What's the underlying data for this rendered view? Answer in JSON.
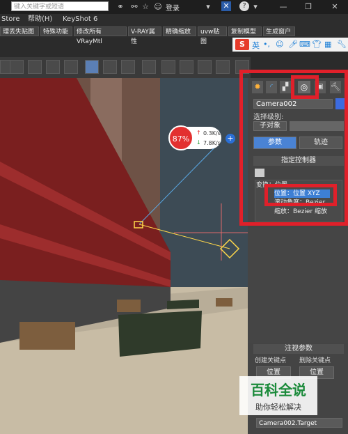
{
  "titlebar": {
    "search_placeholder": "键入关键字或短语",
    "login": "登录",
    "store": "Store"
  },
  "menu": [
    "Store",
    "帮助(H)",
    "KeyShot 6"
  ],
  "plugin_toolbar": [
    "理丢失贴图",
    "特殊功能",
    "修改所有VRayMtl",
    "V-RAY属性",
    "精确缩放",
    "uvw贴图",
    "复制模型",
    "生成窗户"
  ],
  "ime": {
    "logo": "S",
    "lang": "英"
  },
  "viewport": {
    "speed_percent": "87%",
    "upload": "0.3K/s",
    "download": "7.8K/s"
  },
  "panel": {
    "object_name": "Camera002",
    "selection_level_label": "选择级别:",
    "sub_object": "子对象",
    "tab_params": "参数",
    "tab_track": "轨迹",
    "assign_controller": "指定控制器",
    "tree": {
      "root": "变换：位置",
      "position": "位置：位置 XYZ",
      "rotation": "滚动角度：Bezier",
      "scale": "缩放：Bezier 缩放"
    },
    "key_params": "注视参数",
    "create_key": "创建关键点",
    "delete_key": "删除关键点",
    "pos_btn": "位置",
    "pos_btn2": "位置",
    "target": "Camera002.Target"
  },
  "watermark": {
    "title": "百科全说",
    "subtitle": "助你轻松解决"
  }
}
